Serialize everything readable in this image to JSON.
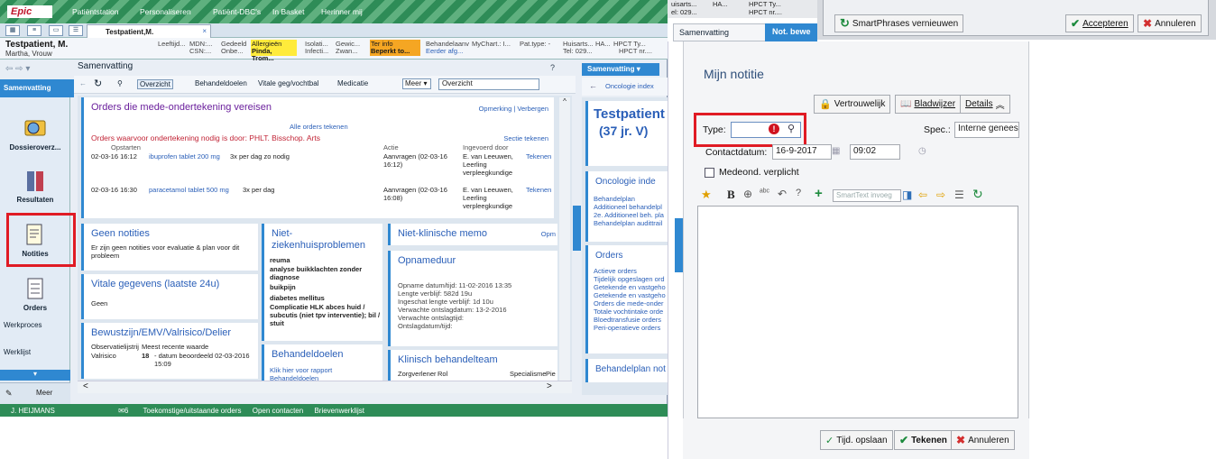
{
  "epic": {
    "logo": "Epic",
    "titlebar_items": [
      "Patiëntstation",
      "Personaliseren",
      "Patiënt-DBC's",
      "In Basket",
      "Herinner mij"
    ],
    "tab_label": "Testpatient,M.",
    "patient": {
      "name": "Testpatient, M.",
      "subname": "Martha, Vrouw",
      "header_cols": [
        {
          "l1": "Leeftijd...",
          "l2": ""
        },
        {
          "l1": "MDN:...",
          "l2": "CSN:..."
        },
        {
          "l1": "Gedeeld",
          "l2": "Onbe..."
        }
      ],
      "allergy_label": "Allergieën",
      "allergy_value": "Pinda, Trom...",
      "isolatie": {
        "l1": "Isolati...",
        "l2": "Infecti..."
      },
      "gewicht": {
        "l1": "Gewic...",
        "l2": "Zwan..."
      },
      "terinfo_label": "Ter info",
      "terinfo_value": "Beperkt to...",
      "behandel": {
        "l1": "Behandelaanv",
        "l2": "Eerder afg..."
      },
      "mychart": "MyChart.: I...",
      "pattype": "Pat.type: -",
      "huisarts": {
        "l1": "Huisarts...",
        "l2": "Tel: 029..."
      },
      "ha": "HA...",
      "hpct": {
        "l1": "HPCT Ty...",
        "l2": "HPCT nr...."
      }
    },
    "nav": {
      "active": "Samenvatting",
      "items": [
        "Dossieroverz...",
        "Resultaten",
        "Notities",
        "Orders"
      ],
      "text_items": [
        "Werkproces",
        "Werklijst"
      ],
      "meer": "Meer"
    },
    "summary": {
      "title": "Samenvatting",
      "toolbar": [
        "Overzicht",
        "Behandeldoelen",
        "Vitale geg/vochtbal",
        "Medicatie"
      ],
      "meer_dd": "Meer",
      "select_value": "Overzicht"
    },
    "orders_card": {
      "title": "Orders die mede-ondertekening vereisen",
      "links": "Opmerking | Verbergen",
      "sign_all": "Alle orders tekenen",
      "required_by": "Orders waarvoor ondertekening nodig is door: PHLT. Bisschop. Arts",
      "section_sign": "Sectie tekenen",
      "col_start": "Opstarten",
      "col_action": "Actie",
      "col_by": "Ingevoerd door",
      "rows": [
        {
          "date": "02-03-16 16:12",
          "med": "ibuprofen tablet 200 mg",
          "dose": "3x per dag zo nodig",
          "action": "Aanvragen (02-03-16 16:12)",
          "by": "E. van Leeuwen, Leerling verpleegkundige",
          "sign": "Tekenen"
        },
        {
          "date": "02-03-16 16:30",
          "med": "paracetamol tablet 500 mg",
          "dose": "3x per dag",
          "action": "Aanvragen (02-03-16 16:08)",
          "by": "E. van Leeuwen, Leerling verpleegkundige",
          "sign": "Tekenen"
        }
      ]
    },
    "geen_notities": {
      "title": "Geen notities",
      "text": "Er zijn geen notities voor evaluatie & plan voor dit probleem"
    },
    "vitale": {
      "title": "Vitale gegevens (laatste 24u)",
      "text": "Geen"
    },
    "bewustzijn": {
      "title": "Bewustzijn/EMV/Valrisico/Delier",
      "col1": "Observatielijstrij",
      "col2": "Meest recente waarde",
      "row_label": "Valrisico",
      "row_value": "18",
      "row_note": "- datum beoordeeld 02-03-2016 15:09"
    },
    "niet_zkh": {
      "title": "Niet-ziekenhuisproblemen",
      "items": [
        "reuma",
        "analyse buikklachten zonder diagnose",
        "buikpijn",
        "diabetes mellitus",
        "Complicatie HLK abces huid / subcutis (niet tpv interventie); bil / stuit"
      ]
    },
    "behandeldoelen": {
      "title": "Behandeldoelen",
      "link": "Klik hier voor rapport",
      "link2": "Behandeldoelen"
    },
    "niet_klin": {
      "title": "Niet-klinische memo",
      "extra": "Opm"
    },
    "opnameduur": {
      "title": "Opnameduur",
      "lines": [
        "Opname datum/tijd: 11-02-2016 13:35",
        "Lengte verblijf: 582d 19u",
        "Ingeschat lengte verblijf: 1d 10u",
        "Verwachte ontslagdatum: 13-2-2016",
        "Verwachte ontslagtijd:",
        "Ontslagdatum/tijd:"
      ]
    },
    "klinisch_team": {
      "title": "Klinisch behandelteam",
      "cols": [
        "Zorgverlener",
        "Rol",
        "Specialisme",
        "Pie"
      ]
    },
    "right_pane": {
      "tab": "Samenvatting",
      "oncologie_link": "Oncologie index",
      "patient_big": "Testpatient",
      "patient_age": "(37 jr. V)",
      "onco_title": "Oncologie inde",
      "onco_links": [
        "Behandelplan",
        "Additioneel behandelpl",
        "2e. Additioneel beh. pla",
        "Behandelplan audittrail"
      ],
      "orders_title": "Orders",
      "orders_links": [
        "Actieve orders",
        "Tijdelijk opgeslagen ord",
        "Getekende en vastgeho",
        "Getekende en vastgeho",
        "Orders die mede-onder",
        "Totale vochtintake orde",
        "Bloedtransfusie orders",
        "Peri-operatieve orders"
      ],
      "behandelplan_not": "Behandelplan not"
    },
    "status": {
      "user": "J. HEIJMANS",
      "count": "6",
      "items": [
        "Toekomstige/uitstaande orders",
        "Open contacten",
        "Brievenwerklijst"
      ]
    }
  },
  "note_window": {
    "top_left": {
      "l1": "uisarts...",
      "l2": "el: 029...",
      "ha": "HA...",
      "hpct1": "HPCT Ty...",
      "hpct2": "HPCT nr...."
    },
    "smartphrases_btn": "SmartPhrases vernieuwen",
    "accept_btn": "Accepteren",
    "cancel_btn": "Annuleren",
    "tabs": [
      "Samenvatting",
      "Not. bewe"
    ],
    "title": "Mijn notitie",
    "btn_vertrouwelijk": "Vertrouwelijk",
    "btn_bladwijzer": "Bladwijzer",
    "btn_details": "Details",
    "type_label": "Type:",
    "type_value": "",
    "spec_label": "Spec.:",
    "spec_value": "Interne geneesk",
    "contact_label": "Contactdatum:",
    "contact_date": "16-9-2017",
    "contact_time": "09:02",
    "checkbox_label": "Medeond. verplicht",
    "smarttext_placeholder": "SmartText invoeg",
    "save_temp_btn": "Tijd. opslaan",
    "sign_btn": "Tekenen",
    "cancel_btn2": "Annuleren",
    "colors": {
      "accent": "#2f88d1",
      "highlight_box": "#e01b24",
      "titlebar": "#2e8c57"
    }
  }
}
